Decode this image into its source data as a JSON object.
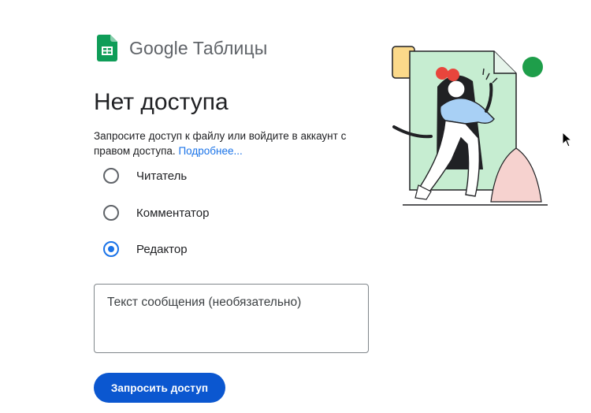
{
  "brand": {
    "google": "Google",
    "product": "Таблицы",
    "icon": "google-sheets-icon",
    "color": "#0f9d58"
  },
  "page": {
    "title": "Нет доступа",
    "description": "Запросите доступ к файлу или войдите в аккаунт с правом доступа.",
    "learn_more": "Подробнее..."
  },
  "roles": [
    {
      "label": "Читатель",
      "checked": false
    },
    {
      "label": "Комментатор",
      "checked": false
    },
    {
      "label": "Редактор",
      "checked": true
    }
  ],
  "message": {
    "placeholder": "Текст сообщения (необязательно)",
    "value": ""
  },
  "submit_label": "Запросить доступ",
  "colors": {
    "accent": "#0b57d0",
    "link": "#1a73e8",
    "radio_selected": "#1a73e8"
  }
}
